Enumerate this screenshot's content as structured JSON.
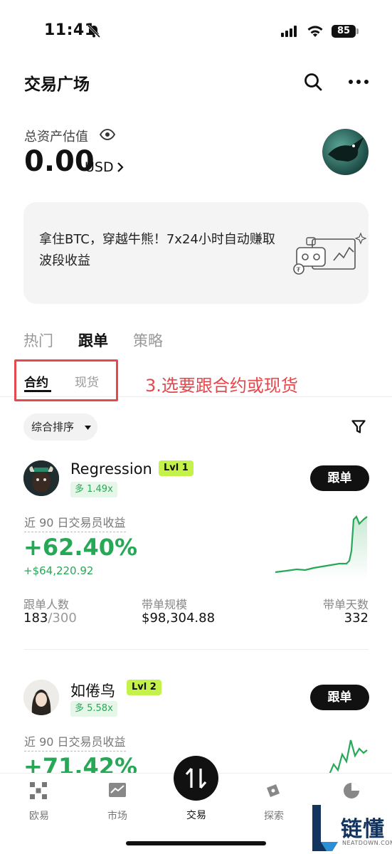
{
  "status_bar": {
    "time": "11:41",
    "battery": "85"
  },
  "header": {
    "title": "交易广场"
  },
  "assets": {
    "label": "总资产估值",
    "value": "0.00",
    "unit": "USD"
  },
  "banner": {
    "text": "拿住BTC，穿越牛熊！7x24小时自动赚取波段收益"
  },
  "tabs": [
    {
      "label": "热门"
    },
    {
      "label": "跟单"
    },
    {
      "label": "策略"
    }
  ],
  "subtabs": [
    {
      "label": "合约"
    },
    {
      "label": "现货"
    }
  ],
  "annotation": "3.选要跟合约或现货",
  "sort": {
    "label": "综合排序"
  },
  "traders": [
    {
      "name": "Regression",
      "level": "Lvl 1",
      "leverage": "多 1.49x",
      "follow_label": "跟单",
      "pnl_label": "近 90 日交易员收益",
      "pnl_pct": "+62.40%",
      "pnl_usd": "+$64,220.92",
      "stats": {
        "followers_label": "跟单人数",
        "followers_current": "183",
        "followers_sep_max": "/300",
        "aum_label": "带单规模",
        "aum_value": "$98,304.88",
        "days_label": "带单天数",
        "days_value": "332"
      }
    },
    {
      "name": "如倦鸟",
      "level": "Lvl 2",
      "leverage": "多 5.58x",
      "follow_label": "跟单",
      "pnl_label": "近 90 日交易员收益",
      "pnl_pct": "+71.42%"
    }
  ],
  "bottom_nav": [
    {
      "label": "欧易",
      "icon": "okx-logo-icon"
    },
    {
      "label": "市场",
      "icon": "market-chart-icon"
    },
    {
      "label": "交易",
      "icon": "swap-arrows-icon"
    },
    {
      "label": "探索",
      "icon": "compass-icon"
    },
    {
      "label": "",
      "icon": "pie-chart-icon"
    }
  ],
  "watermark": {
    "brand": "链懂",
    "url": "NEATDOWN.COM"
  },
  "colors": {
    "gain": "#27a857",
    "level_badge": "#c4f24a",
    "annotation": "#e5484d"
  }
}
